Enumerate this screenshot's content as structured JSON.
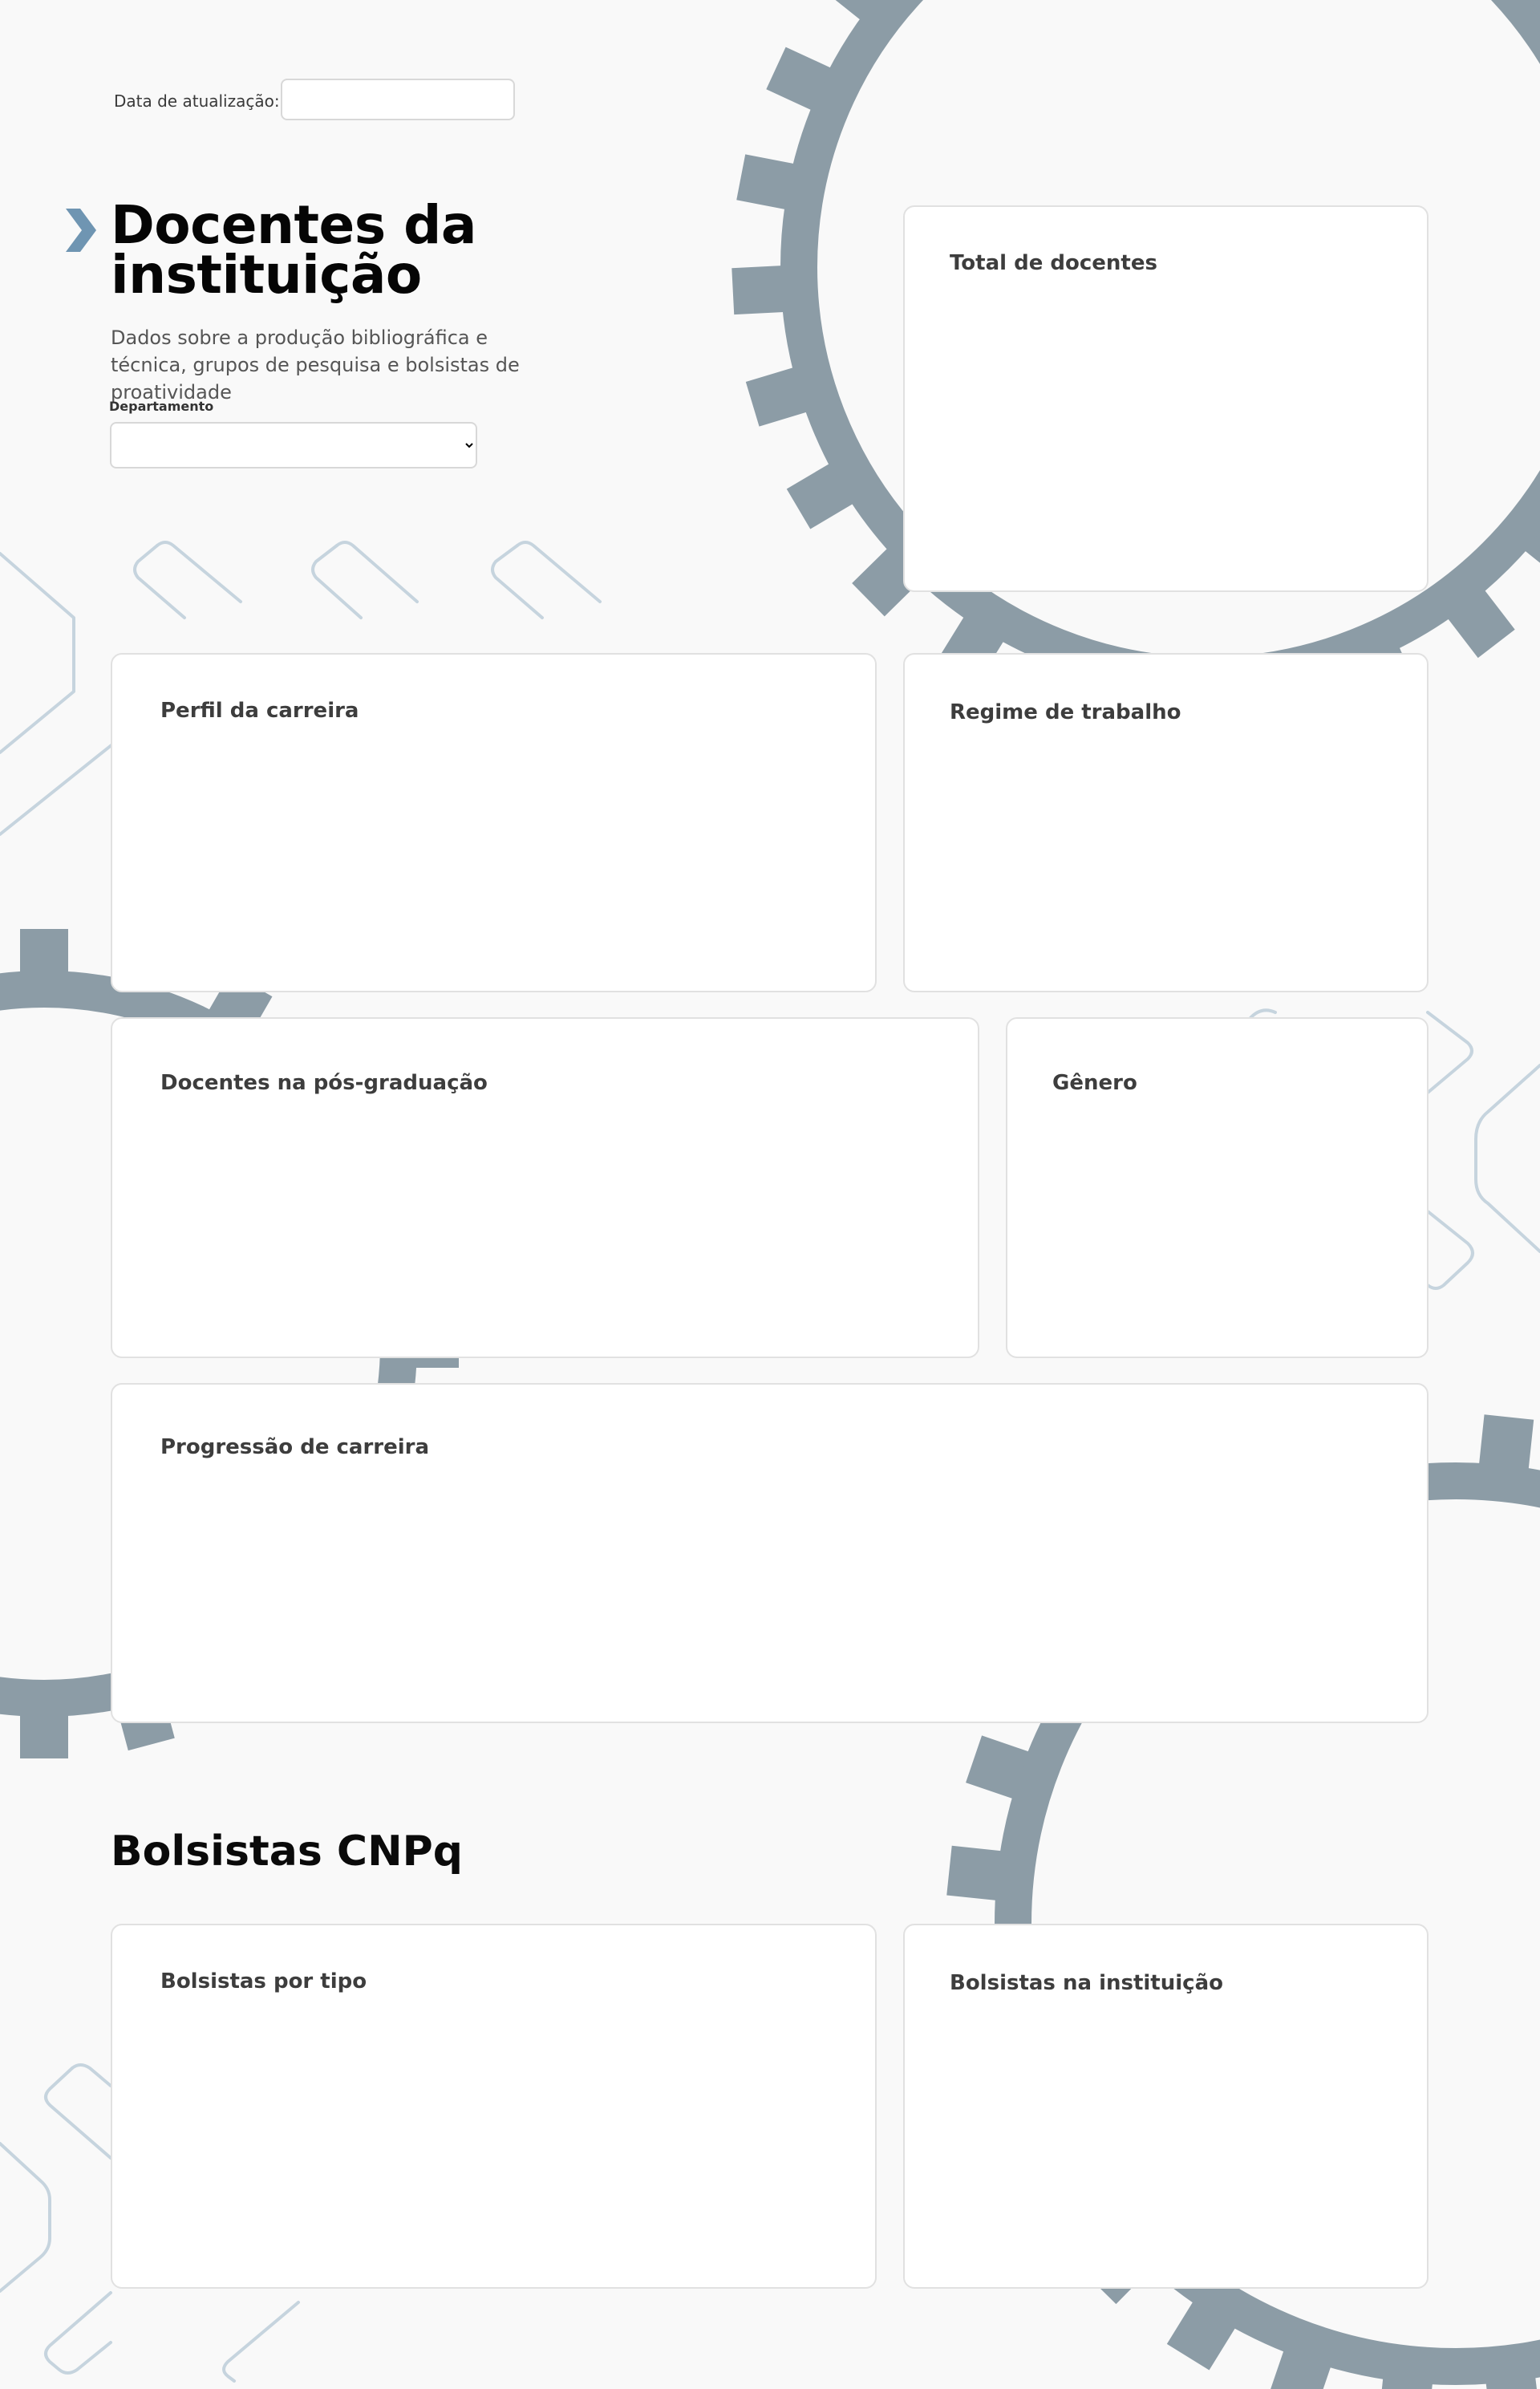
{
  "header": {
    "update_label": "Data de atualização:",
    "update_value": ""
  },
  "hero": {
    "title": "Docentes da instituição",
    "subtitle": "Dados sobre a produção bibliográfica e técnica, grupos de pesquisa e bolsistas de proatividade",
    "department_label": "Departamento",
    "department_value": ""
  },
  "cards": {
    "total_docentes": "Total de docentes",
    "perfil_carreira": "Perfil da carreira",
    "regime_trabalho": "Regime de trabalho",
    "pos_graduacao": "Docentes na pós-graduação",
    "genero": "Gênero",
    "progressao_carreira": "Progressão de carreira",
    "bolsistas_tipo": "Bolsistas por tipo",
    "bolsistas_instituicao": "Bolsistas na instituição"
  },
  "sections": {
    "bolsistas": "Bolsistas CNPq"
  },
  "colors": {
    "gear": "#8c9ca6",
    "outline": "#c6d4de",
    "accent_chevron": "#6f95b2",
    "background": "#f9f9f9"
  },
  "icons": {
    "hero_chevron": "chevron-right-icon"
  }
}
